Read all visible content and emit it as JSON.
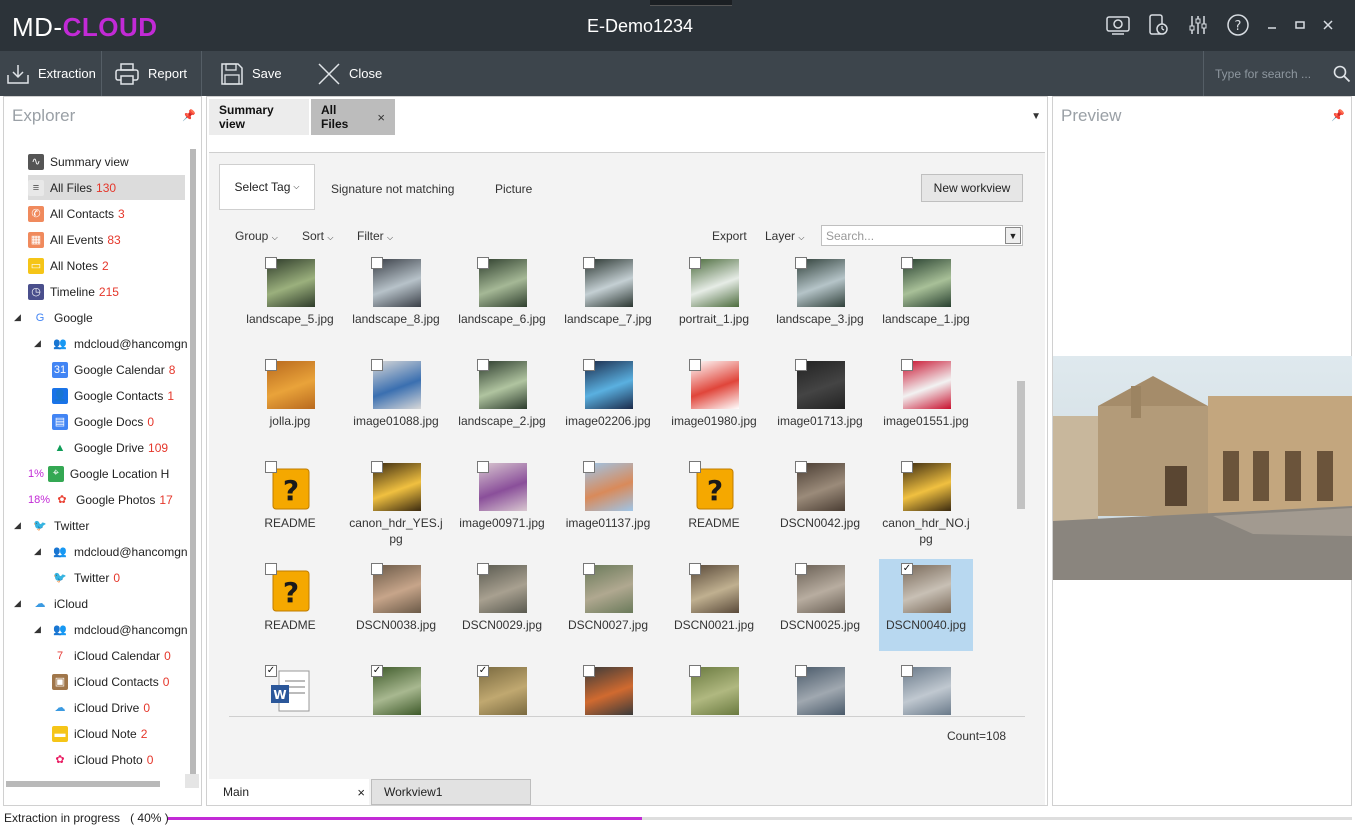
{
  "app": {
    "logo_md": "MD-",
    "logo_cloud": "CLOUD",
    "window_title": "E-Demo1234",
    "title_icons": [
      "camera-icon",
      "device-clock-icon",
      "sliders-icon",
      "help-icon",
      "minimize-icon",
      "maximize-icon",
      "close-icon"
    ]
  },
  "toolbar": {
    "extraction": "Extraction",
    "report": "Report",
    "save": "Save",
    "close": "Close",
    "search_placeholder": "Type for search ..."
  },
  "explorer": {
    "title": "Explorer",
    "items": [
      {
        "label": "Summary view",
        "count": "",
        "icon": "pulse-icon"
      },
      {
        "label": "All Files",
        "count": "130",
        "icon": "file-icon"
      },
      {
        "label": "All Contacts",
        "count": "3",
        "icon": "phone-icon"
      },
      {
        "label": "All Events",
        "count": "83",
        "icon": "calendar-icon"
      },
      {
        "label": "All Notes",
        "count": "2",
        "icon": "note-icon"
      },
      {
        "label": "Timeline",
        "count": "215",
        "icon": "clock-icon"
      },
      {
        "label": "Google",
        "count": "",
        "icon": "google-icon"
      },
      {
        "label": "mdcloud@hancomgn",
        "count": "",
        "icon": "users-icon"
      },
      {
        "label": "Google Calendar",
        "count": "8",
        "icon": "google-calendar-icon"
      },
      {
        "label": "Google Contacts",
        "count": "1",
        "icon": "google-contacts-icon"
      },
      {
        "label": "Google Docs",
        "count": "0",
        "icon": "google-docs-icon"
      },
      {
        "label": "Google Drive",
        "count": "109",
        "icon": "google-drive-icon"
      },
      {
        "label": "Google Location H",
        "count": "",
        "pct": "1%",
        "icon": "google-maps-icon"
      },
      {
        "label": "Google Photos",
        "count": "17",
        "pct": "18%",
        "icon": "google-photos-icon"
      },
      {
        "label": "Twitter",
        "count": "",
        "icon": "twitter-icon"
      },
      {
        "label": "mdcloud@hancomgn",
        "count": "",
        "icon": "users-icon"
      },
      {
        "label": "Twitter",
        "count": "0",
        "icon": "twitter-icon"
      },
      {
        "label": "iCloud",
        "count": "",
        "icon": "icloud-icon"
      },
      {
        "label": "mdcloud@hancomgn",
        "count": "",
        "icon": "users-icon"
      },
      {
        "label": "iCloud Calendar",
        "count": "0",
        "icon": "icloud-calendar-icon"
      },
      {
        "label": "iCloud Contacts",
        "count": "0",
        "icon": "icloud-contacts-icon"
      },
      {
        "label": "iCloud Drive",
        "count": "0",
        "icon": "icloud-drive-icon"
      },
      {
        "label": "iCloud Note",
        "count": "2",
        "icon": "icloud-note-icon"
      },
      {
        "label": "iCloud Photo",
        "count": "0",
        "icon": "icloud-photos-icon"
      }
    ]
  },
  "tabs": {
    "summary": "Summary view",
    "all_files": "All Files",
    "close_glyph": "×"
  },
  "tagbar": {
    "select_tag": "Select Tag",
    "tags": [
      "Signature not matching",
      "Picture"
    ],
    "new_workview": "New workview"
  },
  "controls": {
    "group": "Group",
    "sort": "Sort",
    "filter": "Filter",
    "export": "Export",
    "layer": "Layer",
    "search_placeholder": "Search..."
  },
  "files": [
    {
      "name": "landscape_5.jpg",
      "checked": false,
      "selected": false
    },
    {
      "name": "landscape_8.jpg",
      "checked": false,
      "selected": false
    },
    {
      "name": "landscape_6.jpg",
      "checked": false,
      "selected": false
    },
    {
      "name": "landscape_7.jpg",
      "checked": false,
      "selected": false
    },
    {
      "name": "portrait_1.jpg",
      "checked": false,
      "selected": false
    },
    {
      "name": "landscape_3.jpg",
      "checked": false,
      "selected": false
    },
    {
      "name": "landscape_1.jpg",
      "checked": false,
      "selected": false
    },
    {
      "name": "jolla.jpg",
      "checked": false,
      "selected": false
    },
    {
      "name": "image01088.jpg",
      "checked": false,
      "selected": false
    },
    {
      "name": "landscape_2.jpg",
      "checked": false,
      "selected": false
    },
    {
      "name": "image02206.jpg",
      "checked": false,
      "selected": false
    },
    {
      "name": "image01980.jpg",
      "checked": false,
      "selected": false
    },
    {
      "name": "image01713.jpg",
      "checked": false,
      "selected": false
    },
    {
      "name": "image01551.jpg",
      "checked": false,
      "selected": false
    },
    {
      "name": "README",
      "checked": false,
      "selected": false
    },
    {
      "name": "canon_hdr_YES.jpg",
      "checked": false,
      "selected": false
    },
    {
      "name": "image00971.jpg",
      "checked": false,
      "selected": false
    },
    {
      "name": "image01137.jpg",
      "checked": false,
      "selected": false
    },
    {
      "name": "README",
      "checked": false,
      "selected": false
    },
    {
      "name": "DSCN0042.jpg",
      "checked": false,
      "selected": false
    },
    {
      "name": "canon_hdr_NO.jpg",
      "checked": false,
      "selected": false
    },
    {
      "name": "README",
      "checked": false,
      "selected": false
    },
    {
      "name": "DSCN0038.jpg",
      "checked": false,
      "selected": false
    },
    {
      "name": "DSCN0029.jpg",
      "checked": false,
      "selected": false
    },
    {
      "name": "DSCN0027.jpg",
      "checked": false,
      "selected": false
    },
    {
      "name": "DSCN0021.jpg",
      "checked": false,
      "selected": false
    },
    {
      "name": "DSCN0025.jpg",
      "checked": false,
      "selected": false
    },
    {
      "name": "DSCN0040.jpg",
      "checked": true,
      "selected": true
    },
    {
      "name": "",
      "checked": true,
      "selected": false
    },
    {
      "name": "",
      "checked": true,
      "selected": false
    },
    {
      "name": "",
      "checked": true,
      "selected": false
    },
    {
      "name": "",
      "checked": false,
      "selected": false
    },
    {
      "name": "",
      "checked": false,
      "selected": false
    },
    {
      "name": "",
      "checked": false,
      "selected": false
    },
    {
      "name": "",
      "checked": false,
      "selected": false
    }
  ],
  "count_label": "Count=108",
  "bottom_tabs": {
    "main": "Main",
    "workview": "Workview1"
  },
  "preview": {
    "title": "Preview"
  },
  "status": {
    "text": "Extraction in progress",
    "percent_label": "( 40% )",
    "progress": 0.4
  },
  "colors": {
    "accent": "#c22ad6",
    "count_red": "#e5372b",
    "titlebar": "#2c3339",
    "toolbar": "#3d454c",
    "selection": "#b8d8f0"
  }
}
